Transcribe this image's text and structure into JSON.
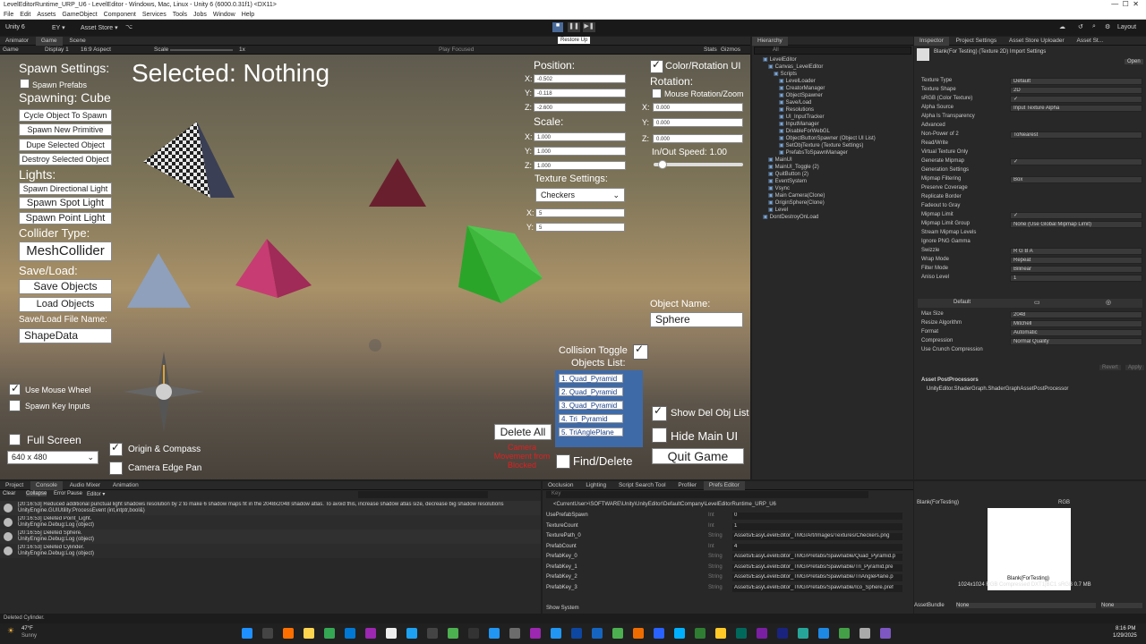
{
  "window": {
    "title": "LevelEditorRuntime_URP_U6 - LevelEditor - Windows, Mac, Linux - Unity 6 (6000.0.31f1) <DX11>"
  },
  "menu": [
    "File",
    "Edit",
    "Assets",
    "GameObject",
    "Component",
    "Services",
    "Tools",
    "Jobs",
    "Window",
    "Help"
  ],
  "toolbar": {
    "account": "Unity 6",
    "ey": "EY ▾",
    "asset_store": "Asset Store ▾",
    "layout": "Layout",
    "tooltip": "Restore Up"
  },
  "left_tabs": [
    "Animator",
    "Game",
    "Scene"
  ],
  "game_bar": {
    "mode": "Game",
    "display": "Display 1",
    "aspect": "16:9 Aspect",
    "scale_label": "Scale",
    "scale_value": "1x",
    "play_focused": "Play Focused",
    "stats": "Stats",
    "gizmos": "Gizmos"
  },
  "game": {
    "spawn_settings": "Spawn Settings:",
    "spawn_prefabs": "Spawn Prefabs",
    "spawning": "Spawning: Cube",
    "cycle": "Cycle Object To Spawn",
    "spawn_new": "Spawn New Primitive",
    "dupe": "Dupe Selected Object",
    "destroy": "Destroy Selected Object",
    "lights": "Lights:",
    "dir_light": "Spawn Directional Light",
    "spot_light": "Spawn Spot Light",
    "point_light": "Spawn Point Light",
    "collider_type": "Collider Type:",
    "mesh_collider": "MeshCollider",
    "save_load": "Save/Load:",
    "save_objects": "Save Objects",
    "load_objects": "Load Objects",
    "file_name_label": "Save/Load File Name:",
    "file_name": "ShapeData",
    "use_mouse_wheel": "Use Mouse Wheel",
    "spawn_key_inputs": "Spawn Key Inputs",
    "full_screen": "Full Screen",
    "resolution": "640 x 480",
    "origin_compass": "Origin & Compass",
    "camera_edge_pan": "Camera Edge Pan",
    "selected": "Selected: Nothing",
    "position": "Position:",
    "pos_x": "-0.502",
    "pos_y": "-0.118",
    "pos_z": "-2.600",
    "scale": "Scale:",
    "scale_x": "1.000",
    "scale_y": "1.000",
    "scale_z": "1.000",
    "texture_settings": "Texture Settings:",
    "texture_dropdown": "Checkers",
    "tex_x": "5",
    "tex_y": "5",
    "color_rotation_ui": "Color/Rotation UI",
    "rotation": "Rotation:",
    "mouse_rotation": "Mouse Rotation/Zoom",
    "rot_x": "0.000",
    "rot_y": "0.000",
    "rot_z": "0.000",
    "inout_speed": "In/Out Speed: 1.00",
    "inout_speed_value": 0.05,
    "object_name_label": "Object Name:",
    "object_name": "Sphere",
    "collision_toggle": "Collision Toggle",
    "objects_list": "Objects List:",
    "list": [
      "1. Quad_Pyramid",
      "2. Quad_Pyramid",
      "3. Quad_Pyramid",
      "4. Tri_Pyramid",
      "5. TriAnglePlane"
    ],
    "delete_all": "Delete All",
    "camera_blocked": "Camera Movement from Blocked",
    "find_delete": "Find/Delete",
    "show_del_obj_list": "Show Del Obj List",
    "hide_main_ui": "Hide Main UI",
    "quit_game": "Quit Game",
    "axis_x": "X:",
    "axis_y": "Y:",
    "axis_z": "Z:"
  },
  "hierarchy": {
    "tab": "Hierarchy",
    "search": "All",
    "items": [
      "LevelEditor",
      "Canvas_LevelEditor",
      "Scripts",
      "LevelLoader",
      "CreatorManager",
      "ObjectSpawner",
      "Save/Load",
      "Resolutions",
      "UI_InputTracker",
      "InputManager",
      "DisableForWebGL",
      "ObjectButtonSpawner (Object UI List)",
      "SetObjTexture (Texture Settings)",
      "PrefabsToSpawnManager",
      "MainUI",
      "MainUI_Toggle (2)",
      "QuitButton (2)",
      "EventSystem",
      "Vsync",
      "Main Camera(Clone)",
      "OriginSphere(Clone)",
      "Level",
      "DontDestroyOnLoad"
    ]
  },
  "inspector": {
    "tabs": [
      "Inspector",
      "Project Settings",
      "Asset Store Uploader",
      "Asset St..."
    ],
    "title": "Blank(For Testing) (Texture 2D) Import Settings",
    "open": "Open",
    "rows": [
      [
        "Texture Type",
        "Default"
      ],
      [
        "Texture Shape",
        "2D"
      ],
      [
        "sRGB (Color Texture)",
        "✓"
      ],
      [
        "Alpha Source",
        "Input Texture Alpha"
      ],
      [
        "Alpha Is Transparency",
        ""
      ],
      [
        "Advanced",
        ""
      ],
      [
        "Non-Power of 2",
        "ToNearest"
      ],
      [
        "Read/Write",
        ""
      ],
      [
        "Virtual Texture Only",
        ""
      ],
      [
        "Generate Mipmap",
        "✓"
      ],
      [
        "Generation Settings",
        ""
      ],
      [
        "Mipmap Filtering",
        "Box"
      ],
      [
        "Preserve Coverage",
        ""
      ],
      [
        "Replicate Border",
        ""
      ],
      [
        "Fadeout to Gray",
        ""
      ],
      [
        "Mipmap Limit",
        "✓"
      ],
      [
        "Mipmap Limit Group",
        "None (Use Global Mipmap Limit)"
      ],
      [
        "Stream Mipmap Levels",
        ""
      ],
      [
        "Ignore PNG Gamma",
        ""
      ],
      [
        "Swizzle",
        "R  G  B  A"
      ],
      [
        "Wrap Mode",
        "Repeat"
      ],
      [
        "Filter Mode",
        "Bilinear"
      ],
      [
        "Aniso Level",
        "1"
      ]
    ],
    "platform_default": "Default",
    "rows2": [
      [
        "Max Size",
        "2048"
      ],
      [
        "Resize Algorithm",
        "Mitchell"
      ],
      [
        "Format",
        "Automatic"
      ],
      [
        "Compression",
        "Normal Quality"
      ],
      [
        "Use Crunch Compression",
        ""
      ]
    ],
    "revert": "Revert",
    "apply": "Apply",
    "postproc": "Asset PostProcessors",
    "postproc_item": "UnityEditor.ShaderGraph.ShaderGraphAssetPostProcessor"
  },
  "console": {
    "tabs": [
      "Project",
      "Console",
      "Audio Mixer",
      "Animation"
    ],
    "toolbar": [
      "Clear",
      "Collapse",
      "Error Pause",
      "Editor ▾"
    ],
    "logs": [
      [
        "[20:16:53] Reduced additional punctual light shadows resolution by 2 to make 6 shadow maps fit in the 2048x2048 shadow atlas. To avoid this, increase shadow atlas size, decrease big shadow resolutions",
        "UnityEngine.GUIUtility:ProcessEvent (int,intptr,bool&)"
      ],
      [
        "[20:16:53] Deleted Point_Light.",
        "UnityEngine.Debug:Log (object)"
      ],
      [
        "[20:16:55] Deleted Sphere.",
        "UnityEngine.Debug:Log (object)"
      ],
      [
        "[20:16:53] Deleted Cylinder.",
        "UnityEngine.Debug:Log (object)"
      ]
    ]
  },
  "prefs": {
    "tabs": [
      "Occlusion",
      "Lighting",
      "Script Search Tool",
      "Profiler",
      "Prefs Editor"
    ],
    "search": "Key",
    "path": "<CurrentUser>\\SOFTWARE\\Unity\\UnityEditor\\DefaultCompany\\LevelEditorRuntime_URP_U6",
    "rows": [
      [
        "UsePrefabSpawn",
        "Int",
        "0"
      ],
      [
        "TextureCount",
        "Int",
        "1"
      ],
      [
        "TexturePath_0",
        "String",
        "Assets/EasyLevelEditor_TMG/Art/Images/Textures/Checkers.png"
      ],
      [
        "PrefabCount",
        "Int",
        "4"
      ],
      [
        "PrefabKey_0",
        "String",
        "Assets/EasyLevelEditor_TMG/Prefabs/Spawnable/Quad_Pyramid.p"
      ],
      [
        "PrefabKey_1",
        "String",
        "Assets/EasyLevelEditor_TMG/Prefabs/Spawnable/Tri_Pyramid.pre"
      ],
      [
        "PrefabKey_2",
        "String",
        "Assets/EasyLevelEditor_TMG/Prefabs/Spawnable/TriAnglePlane.p"
      ],
      [
        "PrefabKey_3",
        "String",
        "Assets/EasyLevelEditor_TMG/Prefabs/Spawnable/Ico_Sphere.pref"
      ]
    ],
    "show_system": "Show System"
  },
  "preview": {
    "name": "Blank(ForTesting)",
    "rgb": "RGB",
    "info": "1024x1024 RGB Compressed DXT1|BC1 sRGB  0.7 MB",
    "caption": "Blank(ForTesting)",
    "assetbundle": "AssetBundle",
    "ab_value": "None",
    "ab_value2": "None"
  },
  "status": {
    "text": "Deleted Cylinder."
  },
  "taskbar": {
    "weather_temp": "47°F",
    "weather_desc": "Sunny",
    "time": "8:16 PM",
    "date": "1/29/2025"
  }
}
